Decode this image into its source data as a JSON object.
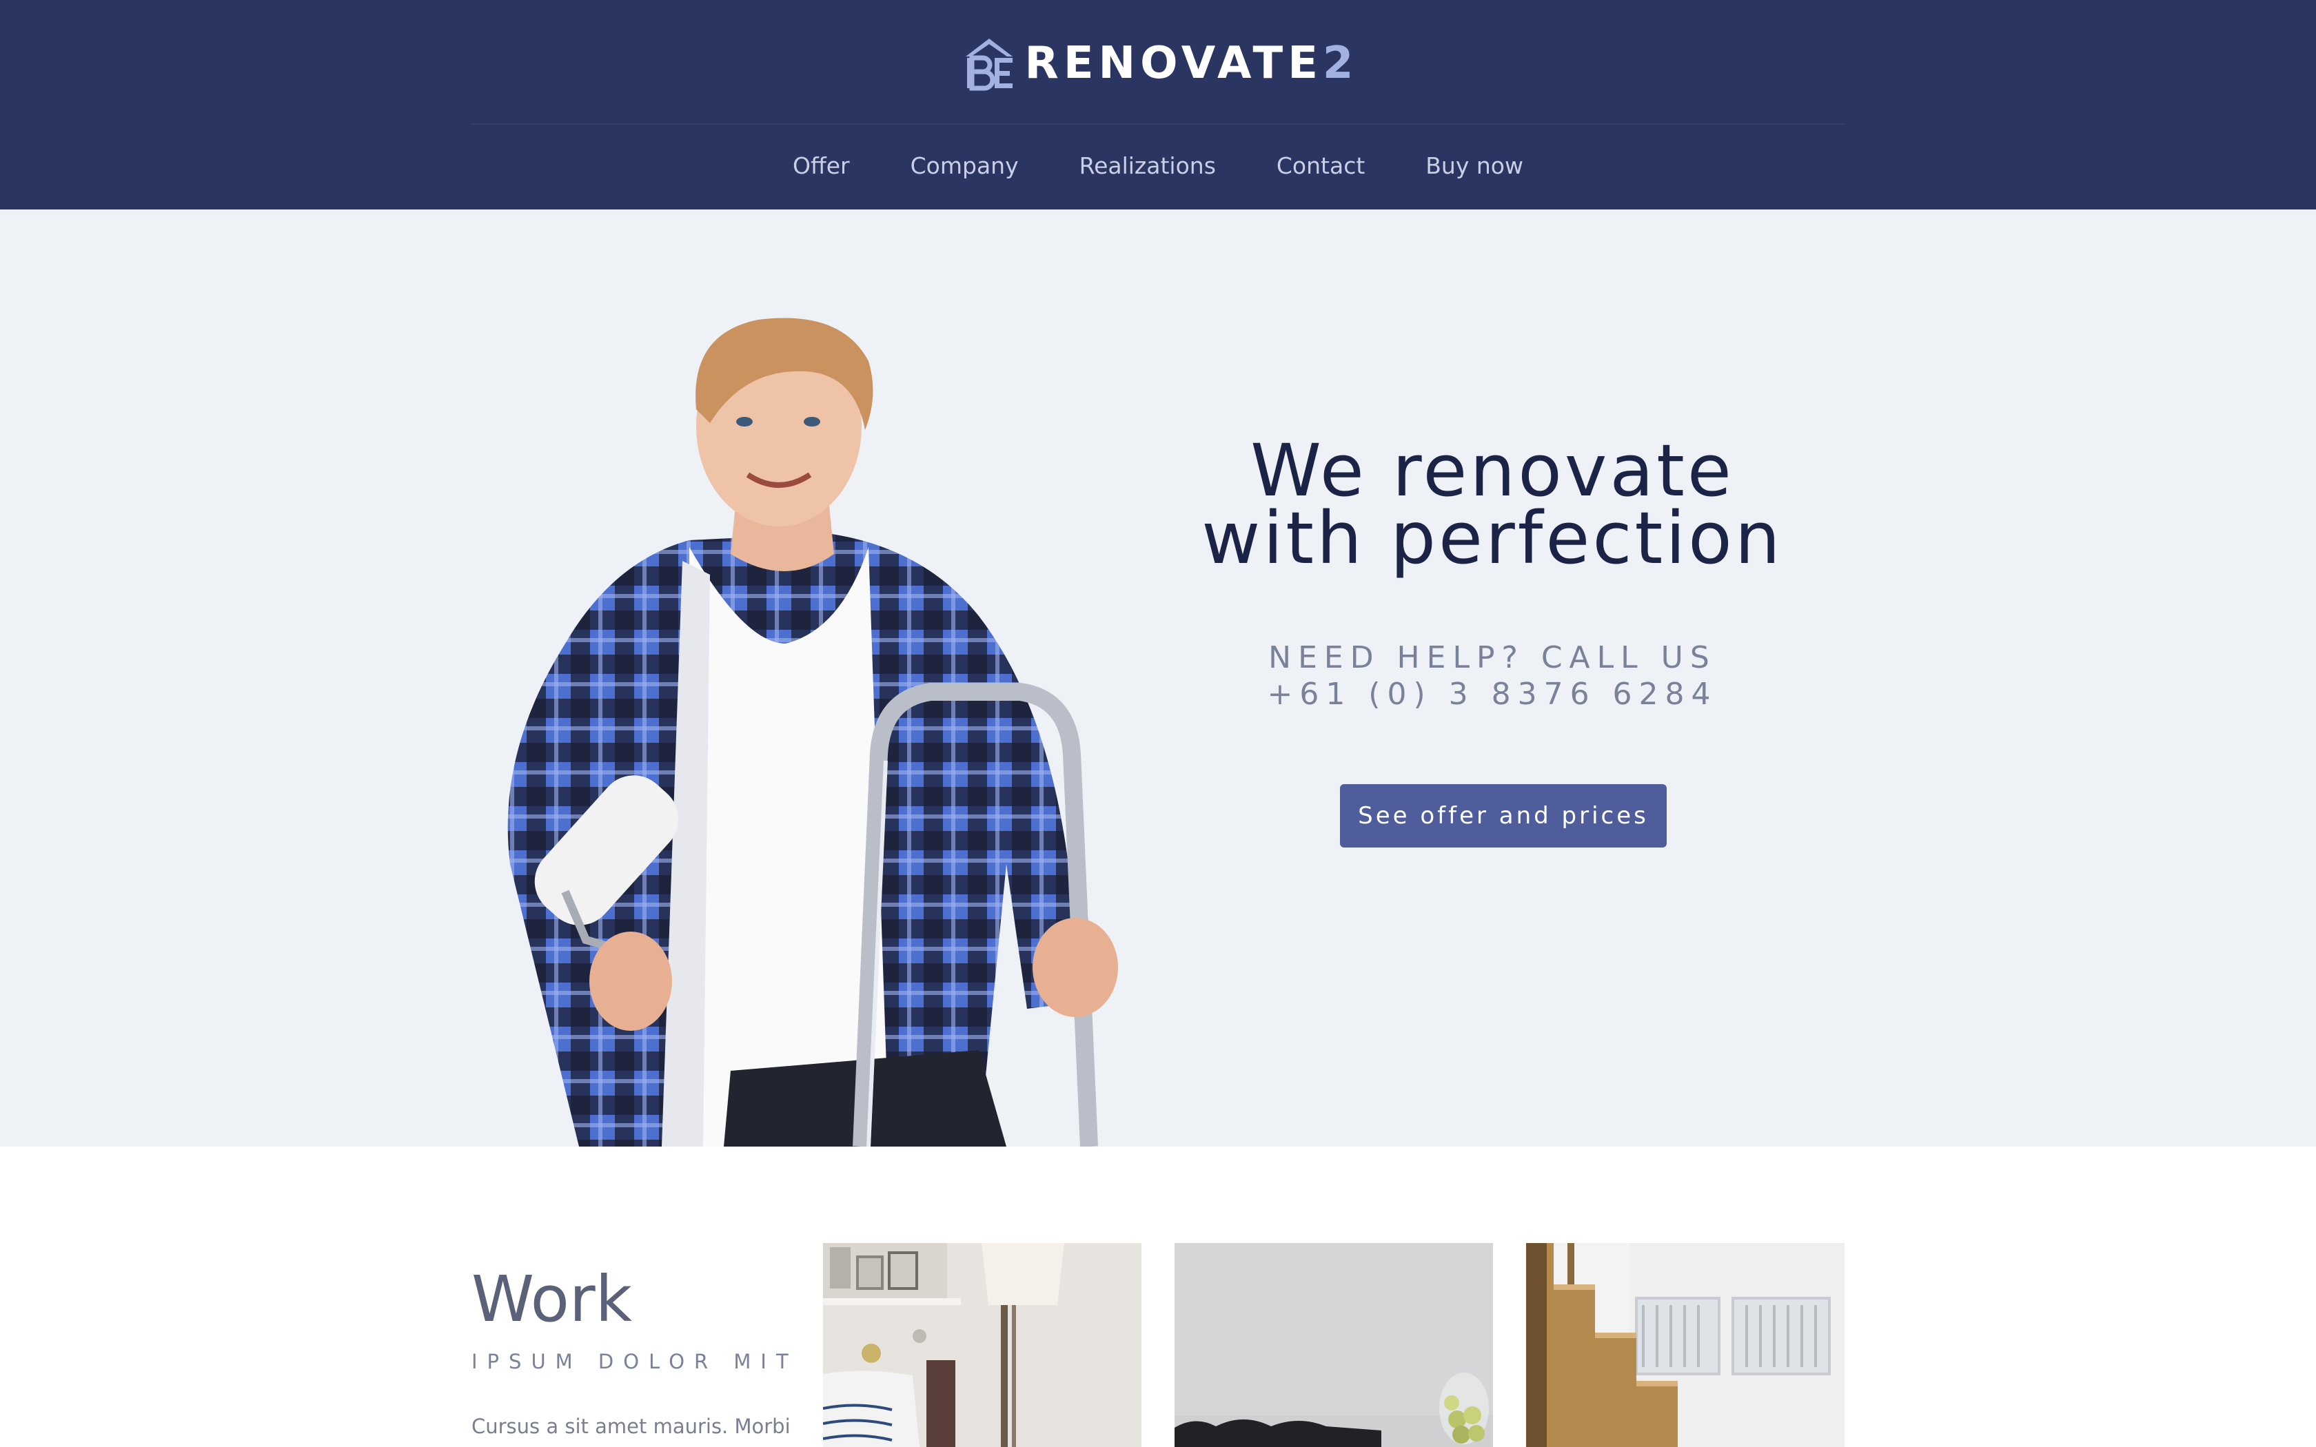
{
  "header": {
    "logo_text": "RENOVATE",
    "logo_number": "2",
    "nav": [
      "Offer",
      "Company",
      "Realizations",
      "Contact",
      "Buy now"
    ]
  },
  "hero": {
    "title_line1": "We renovate",
    "title_line2": "with perfection",
    "help_line1": "NEED HELP? CALL US",
    "help_line2": "+61 (0) 3 8376 6284",
    "cta_label": "See offer and prices"
  },
  "work": {
    "title": "Work",
    "subtitle": "IPSUM DOLOR MIT",
    "text": "Cursus a sit amet mauris. Morbi"
  },
  "colors": {
    "header_bg": "#2b3561",
    "hero_bg": "#eef1f6",
    "accent": "#4f5d9d",
    "title": "#1b2446"
  }
}
